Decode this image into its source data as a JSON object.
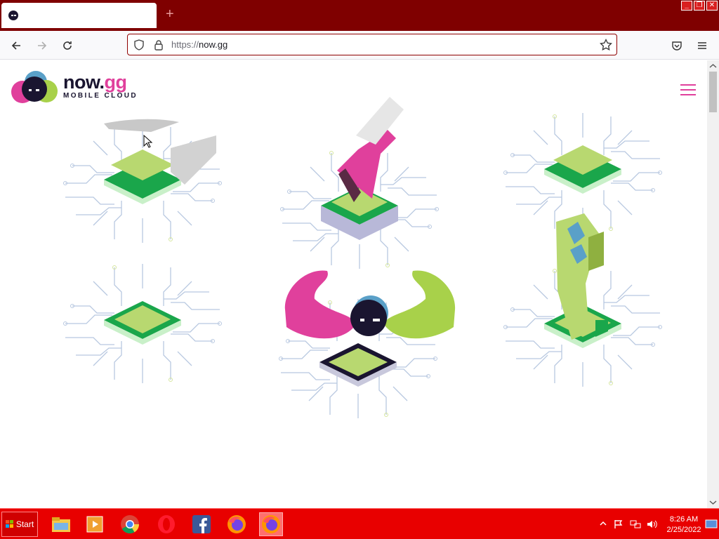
{
  "browser": {
    "tab": {
      "title": ""
    },
    "url": {
      "protocol": "https://",
      "host": "now.gg"
    },
    "new_tab_symbol": "+"
  },
  "window_controls": {
    "minimize": "_",
    "restore": "❐",
    "close": "✕"
  },
  "page": {
    "brand_main": "now.",
    "brand_accent": "gg",
    "tagline": "MOBILE CLOUD",
    "colors": {
      "pink": "#e0409c",
      "green": "#a8d14a",
      "navy": "#1a1530",
      "chip_green": "#1aa64b"
    }
  },
  "taskbar": {
    "start_label": "Start",
    "apps": [
      "file-explorer",
      "media-player",
      "chrome",
      "opera",
      "facebook",
      "firefox",
      "firefox-active"
    ],
    "clock_time": "8:26 AM",
    "clock_date": "2/25/2022"
  }
}
